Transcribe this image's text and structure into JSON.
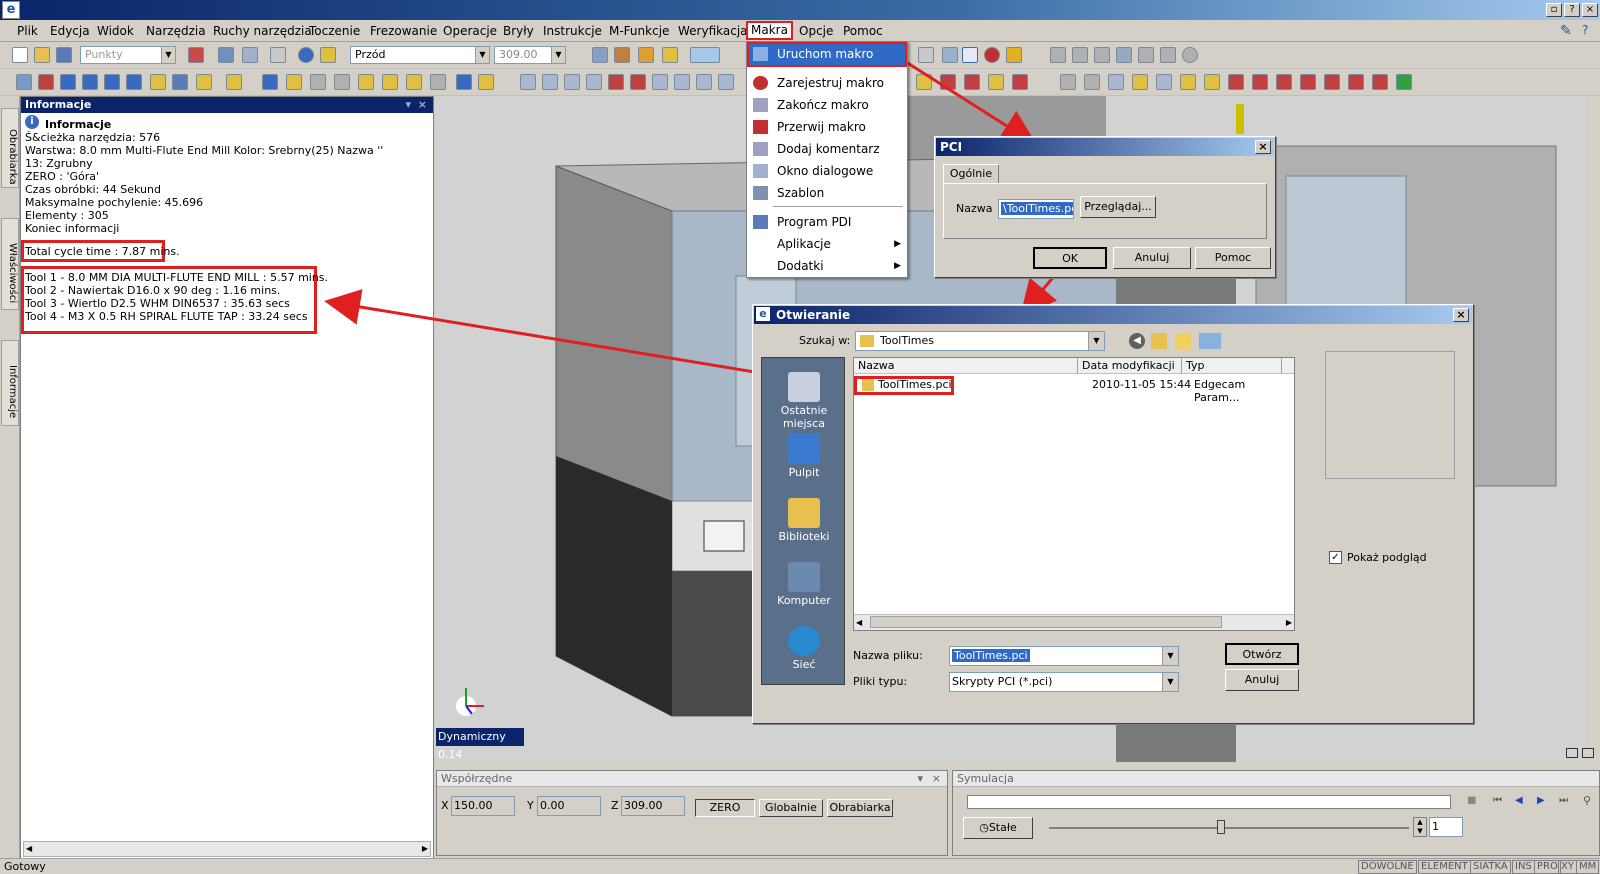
{
  "menubar": {
    "items": [
      "Plik",
      "Edycja",
      "Widok",
      "Narzędzia",
      "Ruchy narzędzia",
      "Toczenie",
      "Frezowanie",
      "Operacje",
      "Bryły",
      "Instrukcje",
      "M-Funkcje",
      "Weryfikacja",
      "Makra",
      "Opcje",
      "Pomoc"
    ],
    "active": "Makra"
  },
  "toolbar": {
    "points_combo": "Punkty",
    "view_combo": "Przód",
    "z_combo": "309.00"
  },
  "left_tabs": [
    "Obrabiarka",
    "Właściwości",
    "Informacje"
  ],
  "info_panel": {
    "title": "Informacje",
    "heading": "Informacje",
    "lines": [
      "Ś&cieżka narzędzia: 576",
      "Warstwa: 8.0 mm Multi-Flute End Mill  Kolor: Srebrny(25)   Nazwa ''",
      "13: Zgrubny",
      "ZERO        : 'Góra'",
      "Czas obróbki: 44 Sekund",
      "Maksymalne pochylenie:  45.696",
      "Elementy   : 305",
      "Koniec informacji"
    ],
    "total_cycle": "Total cycle time : 7.87 mins.",
    "tools": [
      "Tool 1 - 8.0 MM DIA MULTI-FLUTE END MILL : 5.57 mins.",
      "Tool 2 - Nawiertak D16.0 x 90 deg : 1.16 mins.",
      "Tool 3 - Wiertlo D2.5 WHM DIN6537 : 35.63 secs",
      "Tool 4 - M3 X 0.5 RH SPIRAL FLUTE TAP : 33.24 secs"
    ]
  },
  "makra_menu": {
    "items": [
      "Uruchom makro",
      "Zarejestruj makro",
      "Zakończ makro",
      "Przerwij makro",
      "Dodaj komentarz",
      "Okno dialogowe",
      "Szablon",
      "Program PDI",
      "Aplikacje",
      "Dodatki"
    ],
    "highlighted": "Uruchom makro"
  },
  "pci_dialog": {
    "title": "PCI",
    "tab": "Ogólnie",
    "name_label": "Nazwa",
    "name_value": "\\ToolTimes.pci",
    "browse": "Przeglądaj...",
    "ok": "OK",
    "cancel": "Anuluj",
    "help": "Pomoc"
  },
  "open_dialog": {
    "title": "Otwieranie",
    "look_in_label": "Szukaj w:",
    "look_in_value": "ToolTimes",
    "places": [
      "Ostatnie miejsca",
      "Pulpit",
      "Biblioteki",
      "Komputer",
      "Sieć"
    ],
    "columns": [
      "Nazwa",
      "Data modyfikacji",
      "Typ"
    ],
    "files": [
      {
        "name": "ToolTimes.pci",
        "date": "2010-11-05 15:44",
        "type": "Edgecam Param..."
      }
    ],
    "filename_label": "Nazwa pliku:",
    "filename_value": "ToolTimes.pci",
    "filetype_label": "Pliki typu:",
    "filetype_value": "Skrypty PCI (*.pci)",
    "open_btn": "Otwórz",
    "cancel_btn": "Anuluj",
    "preview_label": "Pokaż podgląd",
    "preview_checked": true
  },
  "viewport": {
    "label": "Dynamiczny 0.14"
  },
  "coords_panel": {
    "title": "Współrzędne",
    "x_label": "X",
    "x": "150.00",
    "y_label": "Y",
    "y": "0.00",
    "z_label": "Z",
    "z": "309.00",
    "zero": "ZERO",
    "global": "Globalnie",
    "machine": "Obrabiarka"
  },
  "sim_panel": {
    "title": "Symulacja",
    "mode": "Stałe",
    "speed": "1"
  },
  "statusbar": {
    "text": "Gotowy",
    "cells": [
      "DOWOLNE",
      "ELEMENT",
      "SIATKA",
      "INS",
      "PRO",
      "XY",
      "MM"
    ]
  },
  "colors": {
    "highlight_red": "#e02020",
    "title_blue": "#0a246a",
    "selection": "#316ac5"
  }
}
